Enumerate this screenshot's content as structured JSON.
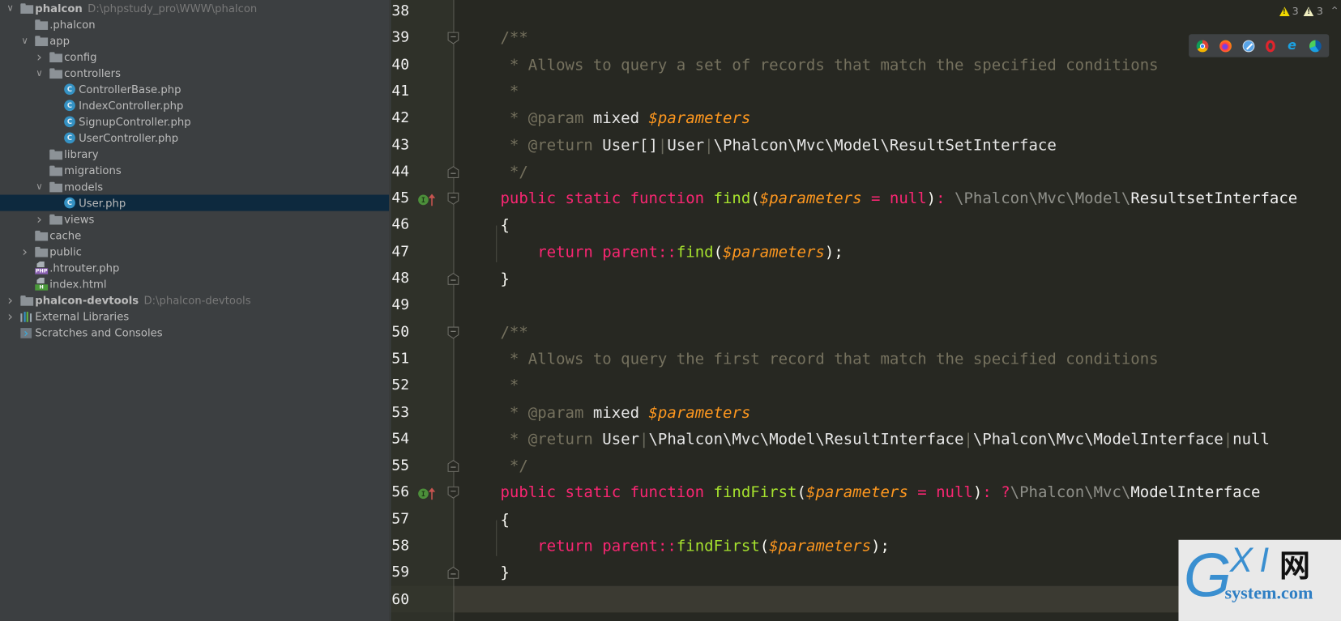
{
  "project_tree": {
    "items": [
      {
        "label": "phalcon",
        "path": "D:\\phpstudy_pro\\WWW\\phalcon",
        "type": "folder",
        "bold": true,
        "expanded": true,
        "depth": 0
      },
      {
        "label": ".phalcon",
        "type": "folder",
        "depth": 1
      },
      {
        "label": "app",
        "type": "folder",
        "expanded": true,
        "depth": 1
      },
      {
        "label": "config",
        "type": "folder",
        "expanded": false,
        "depth": 2
      },
      {
        "label": "controllers",
        "type": "folder",
        "expanded": true,
        "depth": 2
      },
      {
        "label": "ControllerBase.php",
        "type": "class",
        "depth": 3
      },
      {
        "label": "IndexController.php",
        "type": "class",
        "depth": 3
      },
      {
        "label": "SignupController.php",
        "type": "class",
        "depth": 3
      },
      {
        "label": "UserController.php",
        "type": "class",
        "depth": 3
      },
      {
        "label": "library",
        "type": "folder",
        "depth": 2
      },
      {
        "label": "migrations",
        "type": "folder",
        "depth": 2
      },
      {
        "label": "models",
        "type": "folder",
        "expanded": true,
        "depth": 2
      },
      {
        "label": "User.php",
        "type": "class",
        "depth": 3,
        "selected": true
      },
      {
        "label": "views",
        "type": "folder",
        "expanded": false,
        "depth": 2
      },
      {
        "label": "cache",
        "type": "folder",
        "depth": 1
      },
      {
        "label": "public",
        "type": "folder",
        "expanded": false,
        "depth": 1
      },
      {
        "label": ".htrouter.php",
        "type": "php-file",
        "depth": 1
      },
      {
        "label": "index.html",
        "type": "html-file",
        "depth": 1
      },
      {
        "label": "phalcon-devtools",
        "path": "D:\\phalcon-devtools",
        "type": "folder",
        "bold": true,
        "expanded": false,
        "depth": 0
      },
      {
        "label": "External Libraries",
        "type": "library",
        "expanded": false,
        "depth": 0
      },
      {
        "label": "Scratches and Consoles",
        "type": "scratch",
        "depth": 0
      }
    ],
    "class_icon_letter": "C",
    "php_badge": "PHP",
    "html_badge": "H"
  },
  "editor": {
    "warnings": {
      "errors_count": "3",
      "warnings_count": "3"
    },
    "browser_icons": [
      "chrome-icon",
      "firefox-icon",
      "safari-icon",
      "opera-icon",
      "ie-icon",
      "edge-icon"
    ],
    "line_numbers": [
      "38",
      "39",
      "40",
      "41",
      "42",
      "43",
      "44",
      "45",
      "46",
      "47",
      "48",
      "49",
      "50",
      "51",
      "52",
      "53",
      "54",
      "55",
      "56",
      "57",
      "58",
      "59",
      "60"
    ],
    "current_line": "60",
    "lines": [
      [],
      [
        {
          "t": "/**",
          "c": "cmt"
        }
      ],
      [
        {
          "t": " * Allows to query a set of records that match the specified conditions",
          "c": "cmt"
        }
      ],
      [
        {
          "t": " *",
          "c": "cmt"
        }
      ],
      [
        {
          "t": " * ",
          "c": "cmt"
        },
        {
          "t": "@param",
          "c": "tag"
        },
        {
          "t": " mixed ",
          "c": "type"
        },
        {
          "t": "$parameters",
          "c": "var"
        }
      ],
      [
        {
          "t": " * ",
          "c": "cmt"
        },
        {
          "t": "@return",
          "c": "tag"
        },
        {
          "t": " User[]",
          "c": "type"
        },
        {
          "t": "|",
          "c": "sep"
        },
        {
          "t": "User",
          "c": "type"
        },
        {
          "t": "|",
          "c": "sep"
        },
        {
          "t": "\\Phalcon\\Mvc\\Model\\ResultSetInterface",
          "c": "type"
        }
      ],
      [
        {
          "t": " */",
          "c": "cmt"
        }
      ],
      [
        {
          "t": "public static function ",
          "c": "kw"
        },
        {
          "t": "find",
          "c": "fn"
        },
        {
          "t": "(",
          "c": "punct"
        },
        {
          "t": "$parameters",
          "c": "var"
        },
        {
          "t": " = ",
          "c": "kw"
        },
        {
          "t": "null",
          "c": "kw"
        },
        {
          "t": ")",
          "c": "punct"
        },
        {
          "t": ": ",
          "c": "kw"
        },
        {
          "t": "\\Phalcon\\Mvc\\Model\\",
          "c": "ns"
        },
        {
          "t": "ResultsetInterface",
          "c": "cls"
        }
      ],
      [
        {
          "t": "{",
          "c": "punct"
        }
      ],
      [
        {
          "t": "    return ",
          "c": "kw"
        },
        {
          "t": "parent",
          "c": "kw"
        },
        {
          "t": "::",
          "c": "kw"
        },
        {
          "t": "find",
          "c": "fn"
        },
        {
          "t": "(",
          "c": "punct"
        },
        {
          "t": "$parameters",
          "c": "var"
        },
        {
          "t": ");",
          "c": "punct"
        }
      ],
      [
        {
          "t": "}",
          "c": "punct"
        }
      ],
      [],
      [
        {
          "t": "/**",
          "c": "cmt"
        }
      ],
      [
        {
          "t": " * Allows to query the first record that match the specified conditions",
          "c": "cmt"
        }
      ],
      [
        {
          "t": " *",
          "c": "cmt"
        }
      ],
      [
        {
          "t": " * ",
          "c": "cmt"
        },
        {
          "t": "@param",
          "c": "tag"
        },
        {
          "t": " mixed ",
          "c": "type"
        },
        {
          "t": "$parameters",
          "c": "var"
        }
      ],
      [
        {
          "t": " * ",
          "c": "cmt"
        },
        {
          "t": "@return",
          "c": "tag"
        },
        {
          "t": " User",
          "c": "type"
        },
        {
          "t": "|",
          "c": "sep"
        },
        {
          "t": "\\Phalcon\\Mvc\\Model\\ResultInterface",
          "c": "type"
        },
        {
          "t": "|",
          "c": "sep"
        },
        {
          "t": "\\Phalcon\\Mvc\\ModelInterface",
          "c": "type"
        },
        {
          "t": "|",
          "c": "sep"
        },
        {
          "t": "null",
          "c": "type"
        }
      ],
      [
        {
          "t": " */",
          "c": "cmt"
        }
      ],
      [
        {
          "t": "public static function ",
          "c": "kw"
        },
        {
          "t": "findFirst",
          "c": "fn"
        },
        {
          "t": "(",
          "c": "punct"
        },
        {
          "t": "$parameters",
          "c": "var"
        },
        {
          "t": " = ",
          "c": "kw"
        },
        {
          "t": "null",
          "c": "kw"
        },
        {
          "t": ")",
          "c": "punct"
        },
        {
          "t": ": ?",
          "c": "kw"
        },
        {
          "t": "\\Phalcon\\Mvc\\",
          "c": "ns"
        },
        {
          "t": "ModelInterface",
          "c": "cls"
        }
      ],
      [
        {
          "t": "{",
          "c": "punct"
        }
      ],
      [
        {
          "t": "    return ",
          "c": "kw"
        },
        {
          "t": "parent",
          "c": "kw"
        },
        {
          "t": "::",
          "c": "kw"
        },
        {
          "t": "findFirst",
          "c": "fn"
        },
        {
          "t": "(",
          "c": "punct"
        },
        {
          "t": "$parameters",
          "c": "var"
        },
        {
          "t": ");",
          "c": "punct"
        }
      ],
      [
        {
          "t": "}",
          "c": "punct"
        }
      ],
      []
    ]
  },
  "watermark": {
    "g": "G",
    "xi": "XI",
    "net": "网",
    "domain": "system.com"
  }
}
